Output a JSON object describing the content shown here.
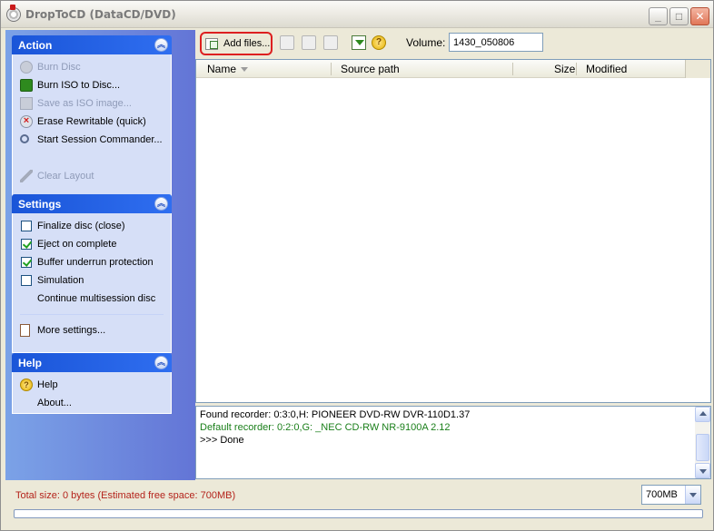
{
  "window": {
    "title": "DropToCD (DataCD/DVD)"
  },
  "action": {
    "title": "Action",
    "items": [
      {
        "label": "Burn Disc",
        "icon": "disc-icon",
        "enabled": false
      },
      {
        "label": "Burn ISO to Disc...",
        "icon": "burn-iso-icon",
        "enabled": true
      },
      {
        "label": "Save as ISO image...",
        "icon": "save-iso-icon",
        "enabled": false
      },
      {
        "label": "Erase Rewritable (quick)",
        "icon": "erase-disc-icon",
        "enabled": true
      },
      {
        "label": "Start Session Commander...",
        "icon": "magnifier-icon",
        "enabled": true
      },
      {
        "label": "Clear Layout",
        "icon": "broom-icon",
        "enabled": false
      }
    ]
  },
  "settings": {
    "title": "Settings",
    "items": [
      {
        "label": "Finalize disc (close)",
        "checked": false
      },
      {
        "label": "Eject on complete",
        "checked": true
      },
      {
        "label": "Buffer underrun protection",
        "checked": true
      },
      {
        "label": "Simulation",
        "checked": false
      }
    ],
    "multisession": "Continue multisession disc",
    "more": "More settings..."
  },
  "help": {
    "title": "Help",
    "items": [
      {
        "label": "Help"
      },
      {
        "label": "About..."
      }
    ]
  },
  "toolbar": {
    "add_files": "Add files...",
    "volume_label": "Volume:",
    "volume_value": "1430_050806"
  },
  "file_list": {
    "columns": [
      "Name",
      "Source path",
      "Size",
      "Modified"
    ],
    "rows": []
  },
  "log": {
    "lines": [
      {
        "text": "Found recorder: 0:3:0,H: PIONEER DVD-RW  DVR-110D1.37",
        "color": "#000000"
      },
      {
        "text": "Default recorder: 0:2:0,G: _NEC    CD-RW NR-9100A  2.12",
        "color": "#1a7f1a"
      },
      {
        "text": ">>> Done",
        "color": "#000000"
      }
    ]
  },
  "status": {
    "total": "Total size: 0 bytes (Estimated free space: 700MB)",
    "capacity": "700MB",
    "progress": 0
  },
  "colors": {
    "accent": "#2f6ef0",
    "status_text": "#b4231b",
    "highlight": "#dd2020"
  }
}
